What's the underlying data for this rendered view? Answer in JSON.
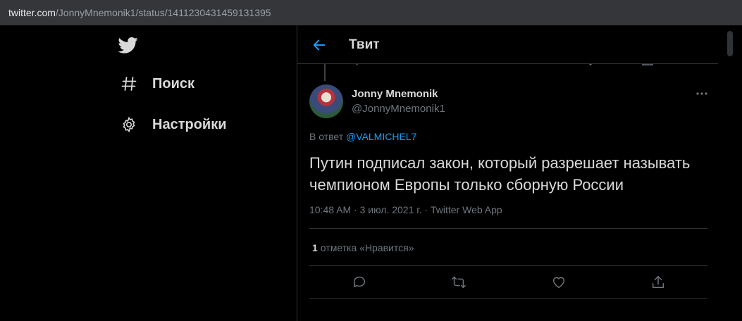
{
  "browser": {
    "url_host": "twitter.com",
    "url_path": "/JonnyMnemonik1/status/1411230431459131395"
  },
  "nav": {
    "logo_icon": "twitter-bird-icon",
    "items": [
      {
        "label": "Поиск",
        "icon": "hashtag-icon"
      },
      {
        "label": "Настройки",
        "icon": "gear-icon"
      }
    ]
  },
  "header": {
    "title": "Твит",
    "back_icon": "arrow-left-icon"
  },
  "tweet": {
    "author_name": "Jonny Mnemonik",
    "author_handle": "@JonnyMnemonik1",
    "reply_prefix": "В ответ",
    "reply_to": "@VALMICHEL7",
    "text": "Путин подписал закон, который разрешает называть чемпионом Европы только сборную России",
    "meta": "10:48 AM · 3 июл. 2021 г. · Twitter Web App",
    "likes_count": "1",
    "likes_label": "отметка «Нравится»"
  },
  "colors": {
    "accent": "#1d9bf0",
    "background": "#000000",
    "border": "#2f3336",
    "muted": "#6e767d"
  }
}
